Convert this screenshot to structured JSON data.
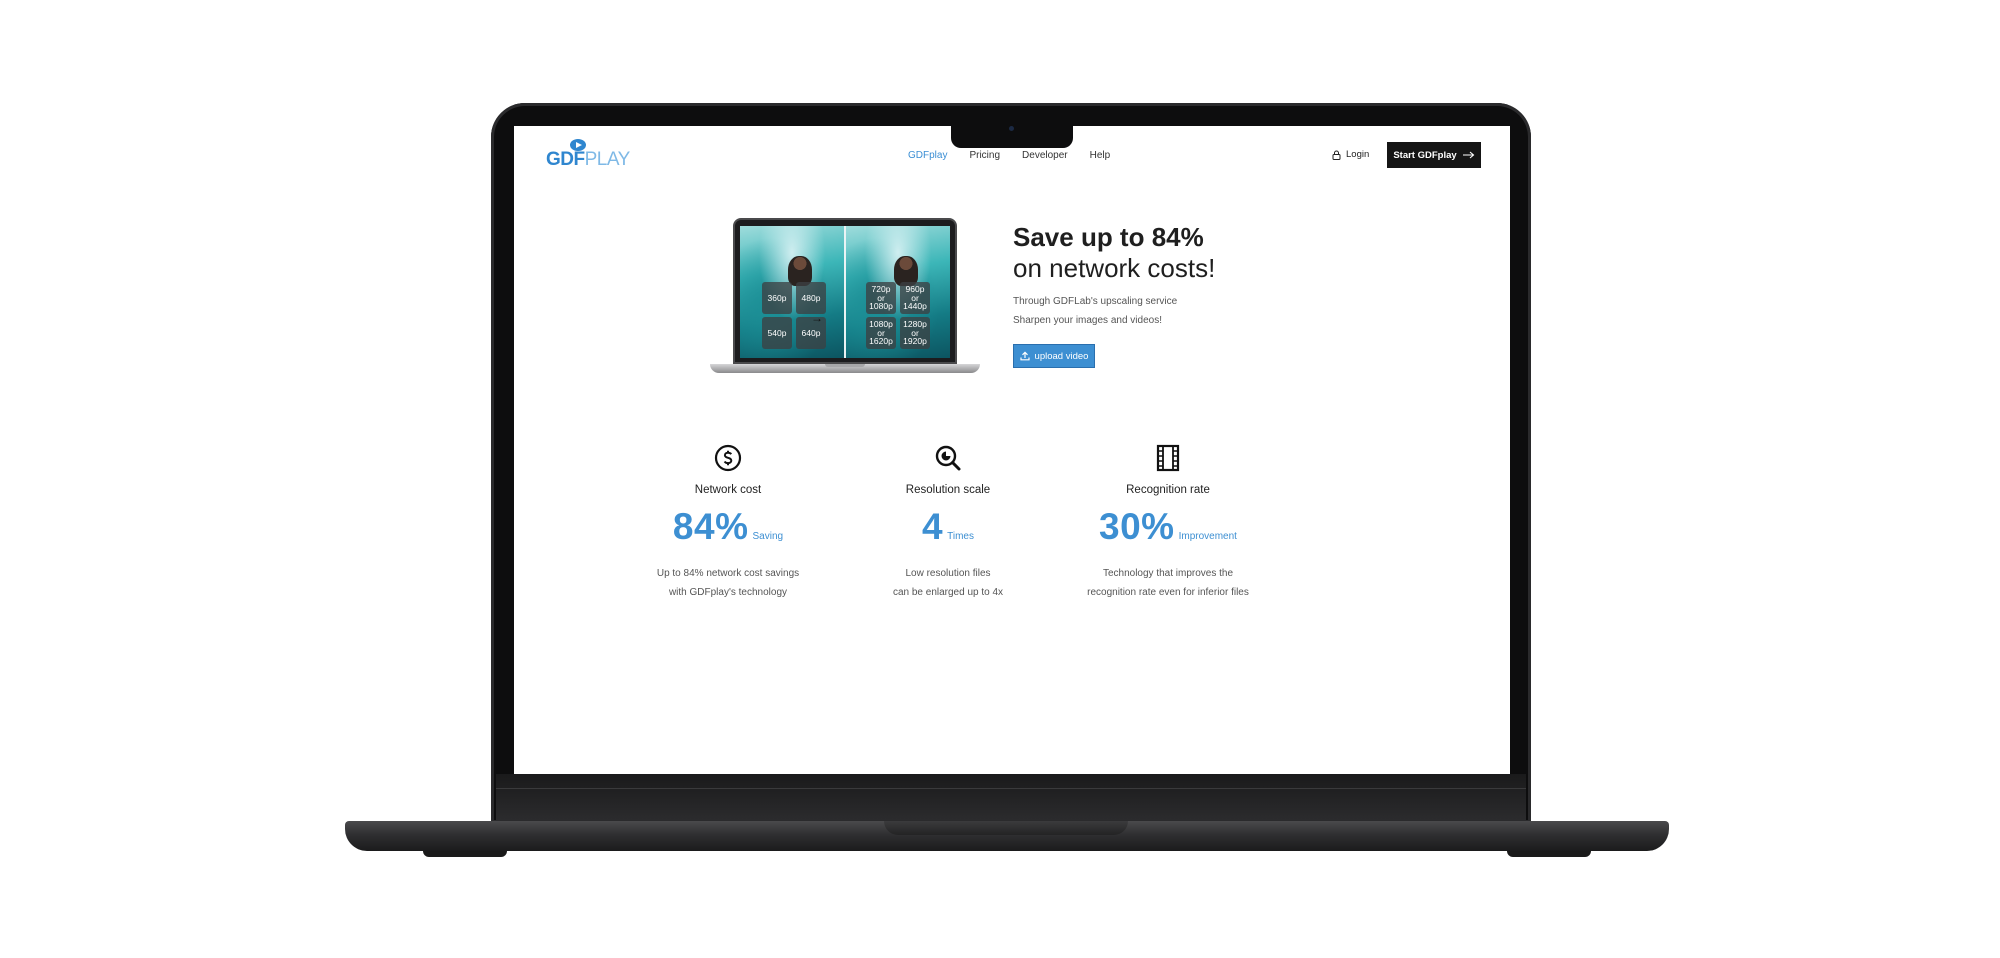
{
  "logo": {
    "part1": "GDF",
    "part2": "PLAY"
  },
  "nav": {
    "items": [
      {
        "label": "GDFplay",
        "active": true
      },
      {
        "label": "Pricing",
        "active": false
      },
      {
        "label": "Developer",
        "active": false
      },
      {
        "label": "Help",
        "active": false
      }
    ]
  },
  "header": {
    "login_label": "Login",
    "start_label": "Start GDFplay"
  },
  "hero": {
    "title_line1": "Save up to 84%",
    "title_line2": "on network costs!",
    "sub_line1": "Through GDFLab's upscaling service",
    "sub_line2": "Sharpen your images and videos!",
    "upload_label": "upload video",
    "resolutions_before": [
      "360p",
      "480p",
      "540p",
      "640p"
    ],
    "resolutions_after": [
      "720p or 1080p",
      "960p or 1440p",
      "1080p or 1620p",
      "1280p or 1920p"
    ]
  },
  "stats": [
    {
      "icon": "dollar-circle-icon",
      "label": "Network cost",
      "value": "84%",
      "unit": "Saving",
      "desc_line1": "Up to 84% network cost savings",
      "desc_line2": "with GDFplay's technology"
    },
    {
      "icon": "search-zoom-icon",
      "label": "Resolution scale",
      "value": "4",
      "unit": "Times",
      "desc_line1": "Low resolution files",
      "desc_line2": "can be enlarged up to 4x"
    },
    {
      "icon": "film-strip-icon",
      "label": "Recognition rate",
      "value": "30%",
      "unit": "Improvement",
      "desc_line1": "Technology that improves the",
      "desc_line2": "recognition rate even for inferior files"
    }
  ],
  "colors": {
    "accent": "#3d8fd2",
    "dark": "#151515",
    "text": "#222222"
  }
}
